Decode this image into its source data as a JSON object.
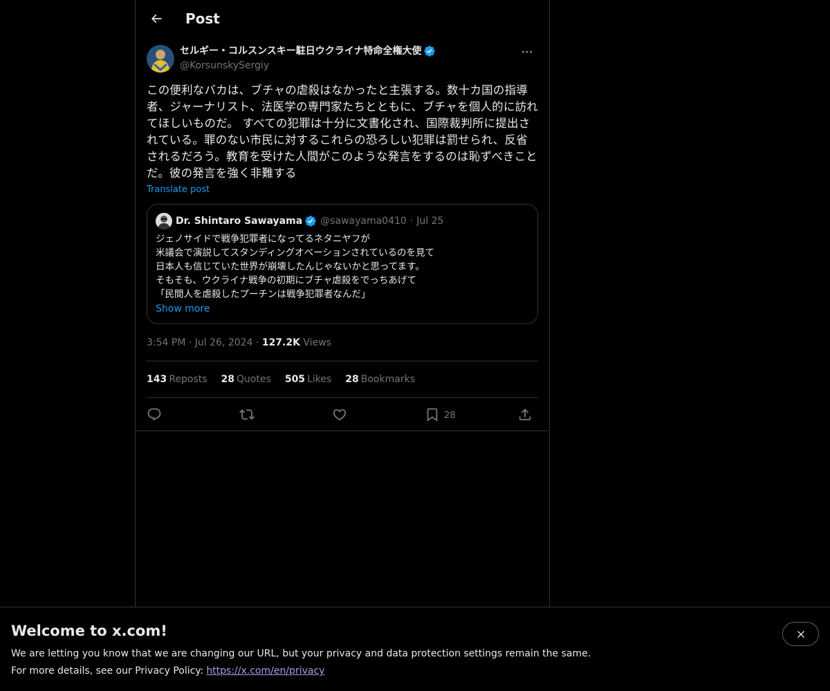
{
  "header": {
    "title": "Post"
  },
  "author": {
    "name": "セルギー・コルスンスキー駐日ウクライナ特命全権大使",
    "handle": "@KorsunskySergiy"
  },
  "post": {
    "text": "この便利なバカは、ブチャの虐殺はなかったと主張する。数十カ国の指導者、ジャーナリスト、法医学の専門家たちとともに、ブチャを個人的に訪れてほしいものだ。 すべての犯罪は十分に文書化され、国際裁判所に提出されている。罪のない市民に対するこれらの恐ろしい犯罪は罰せられ、反省されるだろう。教育を受けた人間がこのような発言をするのは恥ずべきことだ。彼の発言を強く非難する",
    "translate_label": "Translate post"
  },
  "quote": {
    "name": "Dr. Shintaro Sawayama",
    "handle": "@sawayama0410",
    "separator": "·",
    "date": "Jul 25",
    "text": "ジェノサイドで戦争犯罪者になってるネタニヤフが\n米議会で演説してスタンディングオベーションされているのを見て\n日本人も信じていた世界が崩壊したんじゃないかと思ってます。\nそもそも、ウクライナ戦争の初期にブチャ虐殺をでっちあげて\n「民間人を虐殺したプーチンは戦争犯罪者なんだ」",
    "show_more": "Show more"
  },
  "meta": {
    "time": "3:54 PM",
    "date": "Jul 26, 2024",
    "separator": "·",
    "views_count": "127.2K",
    "views_label": "Views"
  },
  "stats": {
    "reposts_count": "143",
    "reposts_label": "Reposts",
    "quotes_count": "28",
    "quotes_label": "Quotes",
    "likes_count": "505",
    "likes_label": "Likes",
    "bookmarks_count": "28",
    "bookmarks_label": "Bookmarks"
  },
  "actions": {
    "bookmark_count": "28"
  },
  "banner": {
    "title": "Welcome to x.com!",
    "line1": "We are letting you know that we are changing our URL, but your privacy and data protection settings remain the same.",
    "line2_prefix": "For more details, see our Privacy Policy:",
    "link": "https://x.com/en/privacy"
  },
  "colors": {
    "background": "#000000",
    "text": "#e7e9ea",
    "muted": "#71767b",
    "accent": "#1d9bf0",
    "border": "#2f3336",
    "link_visited": "#aa9ce8"
  },
  "icons": [
    "back-arrow-icon",
    "verified-badge-icon",
    "more-icon",
    "reply-icon",
    "repost-icon",
    "like-icon",
    "bookmark-icon",
    "share-icon",
    "close-icon"
  ]
}
